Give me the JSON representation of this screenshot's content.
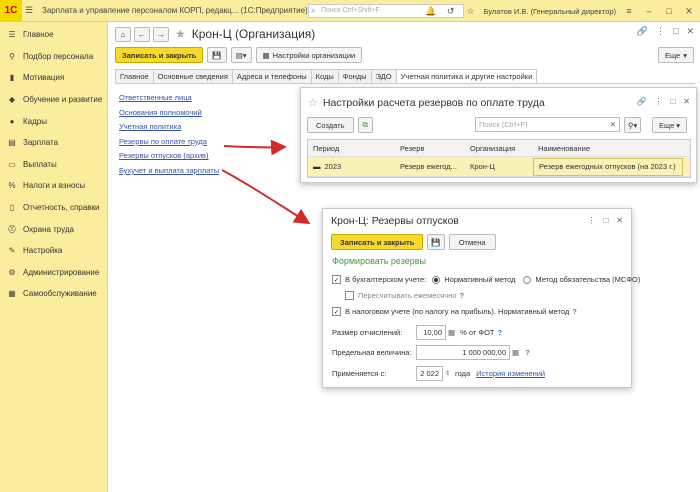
{
  "app": {
    "title": "Зарплата и управление персоналом КОРП, редакц... (1С:Предприятие)",
    "search_placeholder": "Поиск Ctrl+Shift+F",
    "user": "Булатов И.В. (Генеральный директор)"
  },
  "sidebar": {
    "items": [
      {
        "icon": "menu-icon",
        "label": "Главное"
      },
      {
        "icon": "search-icon",
        "label": "Подбор персонала"
      },
      {
        "icon": "chart-icon",
        "label": "Мотивация"
      },
      {
        "icon": "education-icon",
        "label": "Обучение и развитие"
      },
      {
        "icon": "people-icon",
        "label": "Кадры"
      },
      {
        "icon": "salary-icon",
        "label": "Зарплата"
      },
      {
        "icon": "payments-icon",
        "label": "Выплаты"
      },
      {
        "icon": "percent-icon",
        "label": "Налоги и взносы"
      },
      {
        "icon": "report-icon",
        "label": "Отчетность, справки"
      },
      {
        "icon": "safety-icon",
        "label": "Охрана труда"
      },
      {
        "icon": "wrench-icon",
        "label": "Настройка"
      },
      {
        "icon": "gear-icon",
        "label": "Администрирование"
      },
      {
        "icon": "self-service-icon",
        "label": "Самообслуживание"
      }
    ]
  },
  "org": {
    "title": "Крон-Ц (Организация)",
    "save_close": "Записать и закрыть",
    "settings": "Настройки организации",
    "more": "Еще"
  },
  "tabs": [
    "Главное",
    "Основные сведения",
    "Адреса и телефоны",
    "Коды",
    "Фонды",
    "ЭДО",
    "Учетная политика и другие настройки"
  ],
  "links": [
    "Ответственные лица",
    "Основания полномочий",
    "Учетная политика",
    "Резервы по оплате труда",
    "Резервы отпусков (архив)",
    "Бухучет и выплата зарплаты"
  ],
  "reserve_settings": {
    "title": "Настройки расчета резервов по оплате труда",
    "create": "Создать",
    "search_placeholder": "Поиск (Ctrl+F)",
    "more": "Еще",
    "columns": [
      "Период",
      "Резерв",
      "Организация",
      "Наименование"
    ],
    "rows": [
      {
        "period": "2023",
        "reserve": "Резерв ежегод...",
        "org": "Крон-Ц",
        "name": "Резерв ежегодных отпусков (на 2023 г.)"
      }
    ]
  },
  "vacation_reserve": {
    "title": "Крон-Ц: Резервы отпусков",
    "save_close": "Записать и закрыть",
    "cancel": "Отмена",
    "section": "Формировать резервы",
    "accounting": "В бухгалтерском учете:",
    "method_normative": "Нормативный метод",
    "method_ifrs": "Метод обязательства (МСФО)",
    "monthly": "Пересчитывать ежемесячно",
    "tax": "В налоговом учете (по налогу на прибыль). Нормативный метод",
    "rate_label": "Размер отчислений:",
    "rate_value": "10,00",
    "rate_unit": "% от ФОТ",
    "limit_label": "Предельная величина:",
    "limit_value": "1 000 000,00",
    "applies_label": "Применяется с:",
    "applies_year": "2 022",
    "applies_unit": "года",
    "history": "История изменений"
  },
  "colors": {
    "accent_yellow": "#f7d92c",
    "sidebar_bg": "#fbed9e",
    "arrow_red": "#d22b2b",
    "link": "#3355aa",
    "section_green": "#3c9a3c"
  }
}
